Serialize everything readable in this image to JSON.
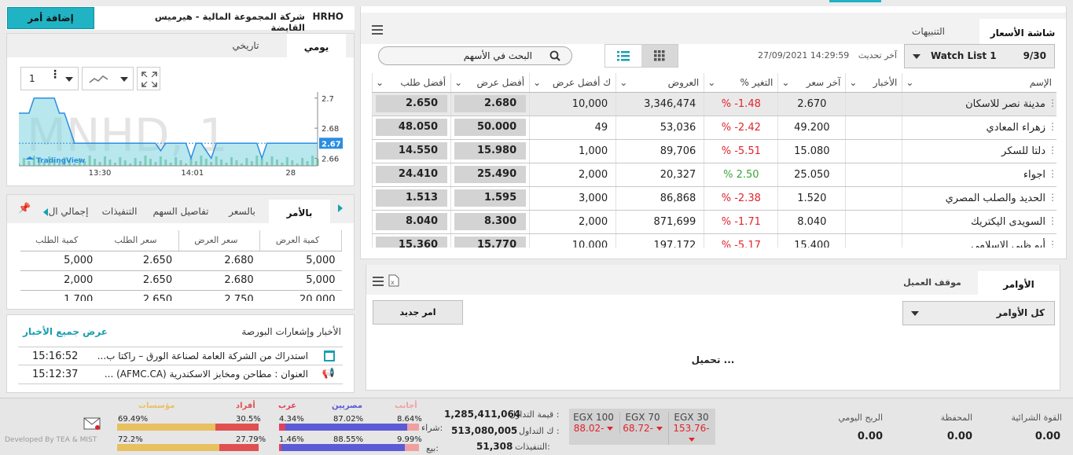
{
  "header": {
    "symbol": "HRHO",
    "company": "شركة المجموعة المالية - هيرميس القابضة",
    "add_order": "إضافة أمر"
  },
  "chart_tabs": {
    "daily": "يومي",
    "history": "تاريخي"
  },
  "chart_toolbar": {
    "interval": "1"
  },
  "chart": {
    "type": "area",
    "watermark": "MNHD, 1",
    "x_ticks": [
      "13:30",
      "14:01",
      "28"
    ],
    "y_ticks": [
      "2.7",
      "2.68",
      "2.67",
      "2.66"
    ],
    "last_price": "2.67",
    "brand": "TradingView",
    "ylim": [
      2.655,
      2.702
    ],
    "values": [
      2.69,
      2.69,
      2.69,
      2.7,
      2.7,
      2.7,
      2.7,
      2.7,
      2.69,
      2.69,
      2.68,
      2.67,
      2.67,
      2.67,
      2.67,
      2.67,
      2.67,
      2.67,
      2.67,
      2.67,
      2.67,
      2.67,
      2.67,
      2.67,
      2.67,
      2.67,
      2.67,
      2.67,
      2.665,
      2.67,
      2.67,
      2.67,
      2.67,
      2.67,
      2.66,
      2.67,
      2.67,
      2.665,
      2.66,
      2.67,
      2.67,
      2.67,
      2.67,
      2.67,
      2.67,
      2.67,
      2.67,
      2.67,
      2.66,
      2.67,
      2.67,
      2.67,
      2.67,
      2.67,
      2.67,
      2.67,
      2.67,
      2.67,
      2.67,
      2.67
    ]
  },
  "depth_tabs": {
    "by_order": "بالأمر",
    "by_price": "بالسعر",
    "stock_details": "تفاصيل السهم",
    "executions": "التنفيذات",
    "total": "إجمالي ال"
  },
  "depth": {
    "headers": [
      "كمية العرض",
      "سعر العرض",
      "سعر الطلب",
      "كمية الطلب"
    ],
    "rows": [
      [
        "5,000",
        "2.680",
        "2.650",
        "5,000"
      ],
      [
        "5,000",
        "2.680",
        "2.650",
        "2,000"
      ],
      [
        "20,000",
        "2.750",
        "2.650",
        "1,700"
      ]
    ]
  },
  "news": {
    "title": "الأخبار وإشعارات البورصة",
    "view_all": "عرض جميع الأخبار",
    "items": [
      {
        "text": "استدراك من الشركة العامة لصناعة الورق – راكتا ب...",
        "time": "15:16:52"
      },
      {
        "text": "العنوان : مطاحن ومخابز الاسكندرية (AFMC.CA) ...",
        "time": "15:12:37"
      }
    ]
  },
  "watch_tabs": {
    "screen": "شاشة الأسعار",
    "alerts": "التنبيهات"
  },
  "watch": {
    "list_name": "Watch List 1",
    "count": "9/30",
    "updated_label": "آخر تحديث",
    "updated": "27/09/2021 14:29:59",
    "search_placeholder": "البحث في الأسهم",
    "headers": [
      "الإسم",
      "الأخبار",
      "آخر سعر",
      "التغير %",
      "العروض",
      "ك أفضل عرض",
      "أفضل عرض",
      "أفضل طلب"
    ],
    "rows": [
      {
        "name": "مدينة نصر للاسكان",
        "last": "2.670",
        "chg": "-1.48",
        "dir": "down",
        "offers": "3,346,474",
        "best_qty": "10,000",
        "ask": "2.680",
        "bid": "2.650"
      },
      {
        "name": "زهراء المعادي",
        "last": "49.200",
        "chg": "-2.42",
        "dir": "down",
        "offers": "53,036",
        "best_qty": "49",
        "ask": "50.000",
        "bid": "48.050"
      },
      {
        "name": "دلتا للسكر",
        "last": "15.080",
        "chg": "-5.51",
        "dir": "down",
        "offers": "89,706",
        "best_qty": "1,000",
        "ask": "15.980",
        "bid": "14.550"
      },
      {
        "name": "اجواء",
        "last": "25.050",
        "chg": "2.50",
        "dir": "up",
        "offers": "20,327",
        "best_qty": "2,000",
        "ask": "25.490",
        "bid": "24.410"
      },
      {
        "name": "الحديد والصلب المصري",
        "last": "1.520",
        "chg": "-2.38",
        "dir": "down",
        "offers": "86,868",
        "best_qty": "3,000",
        "ask": "1.595",
        "bid": "1.513"
      },
      {
        "name": "السويدى اليكتريك",
        "last": "8.040",
        "chg": "-1.71",
        "dir": "down",
        "offers": "871,699",
        "best_qty": "2,000",
        "ask": "8.300",
        "bid": "8.040"
      },
      {
        "name": "أبو ظبي الإسلامي",
        "last": "15.400",
        "chg": "-5.17",
        "dir": "down",
        "offers": "197,172",
        "best_qty": "10,000",
        "ask": "15.770",
        "bid": "15.360"
      }
    ]
  },
  "orders": {
    "tab_orders": "الأوامر",
    "tab_position": "موقف العميل",
    "filter": "كل الأوامر",
    "new_order": "امر جديد",
    "loading": "تحميل ..."
  },
  "footer": {
    "buying_power_label": "القوة الشرائية",
    "buying_power": "0.00",
    "portfolio_label": "المحفظة",
    "portfolio": "0.00",
    "daily_profit_label": "الربح اليومي",
    "daily_profit": "0.00",
    "indices": [
      {
        "name": "EGX 30",
        "change": "153.76-"
      },
      {
        "name": "EGX 70",
        "change": "68.72-"
      },
      {
        "name": "EGX 100",
        "change": "88.02-"
      }
    ],
    "trade_value_label": "قيمة التداول :",
    "trade_value": "1,285,411,064",
    "trade_volume_label": "ك التداول :",
    "trade_volume": "513,080,005",
    "executions_label": "التنفيذات:",
    "executions": "51,308",
    "buy_label": "شراء:",
    "sell_label": "بيع:",
    "groups": [
      {
        "name": "أجانب",
        "buy": "8.64%",
        "sell": "9.99%",
        "buyv": 8.64,
        "sellv": 9.99,
        "color": "#f0a0a0"
      },
      {
        "name": "مصريين",
        "buy": "87.02%",
        "sell": "88.55%",
        "buyv": 87.02,
        "sellv": 88.55,
        "color": "#5b5bd6"
      },
      {
        "name": "عرب",
        "buy": "4.34%",
        "sell": "1.46%",
        "buyv": 4.34,
        "sellv": 1.46,
        "color": "#e04060"
      },
      {
        "name": "أفراد",
        "buy": "30.5%",
        "sell": "27.79%",
        "buyv": 30.5,
        "sellv": 27.79,
        "color": "#e05050"
      },
      {
        "name": "مؤسسات",
        "buy": "69.49%",
        "sell": "72.2%",
        "buyv": 69.49,
        "sellv": 72.2,
        "color": "#e8c060"
      }
    ],
    "credit": "Developed By TEA & MIST"
  }
}
